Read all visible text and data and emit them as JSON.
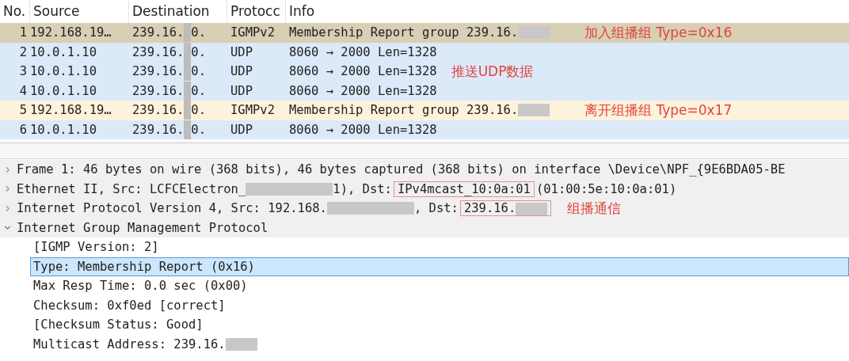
{
  "packet_list": {
    "columns": [
      "No.",
      "Source",
      "Destination",
      "Protocc",
      "Info"
    ],
    "rows": [
      {
        "no": "1",
        "source": "192.168.19…",
        "destination": [
          {
            "kind": "text",
            "text": "239.16."
          },
          {
            "kind": "redacted"
          },
          {
            "kind": "text",
            "text": "0."
          }
        ],
        "protocol": "IGMPv2",
        "info": [
          {
            "kind": "text",
            "text": "Membership Report group 239.16."
          },
          {
            "kind": "redacted"
          }
        ],
        "color": "#d8cfb4",
        "note": "加入组播组 Type=0x16"
      },
      {
        "no": "2",
        "source": "10.0.1.10",
        "destination": [
          {
            "kind": "text",
            "text": "239.16."
          },
          {
            "kind": "redacted"
          },
          {
            "kind": "text",
            "text": "0."
          }
        ],
        "protocol": "UDP",
        "info": [
          {
            "kind": "text",
            "text": "8060 → 2000 Len=1328"
          }
        ],
        "color": "#dbe9f8"
      },
      {
        "no": "3",
        "source": "10.0.1.10",
        "destination": [
          {
            "kind": "text",
            "text": "239.16."
          },
          {
            "kind": "redacted"
          },
          {
            "kind": "text",
            "text": "0."
          }
        ],
        "protocol": "UDP",
        "info": [
          {
            "kind": "text",
            "text": "8060 → 2000 Len=1328"
          }
        ],
        "color": "#dbe9f8",
        "side_note": "推送UDP数据"
      },
      {
        "no": "4",
        "source": "10.0.1.10",
        "destination": [
          {
            "kind": "text",
            "text": "239.16."
          },
          {
            "kind": "redacted"
          },
          {
            "kind": "text",
            "text": "0."
          }
        ],
        "protocol": "UDP",
        "info": [
          {
            "kind": "text",
            "text": "8060 → 2000 Len=1328"
          }
        ],
        "color": "#dbe9f8"
      },
      {
        "no": "5",
        "source": "192.168.19…",
        "destination": [
          {
            "kind": "text",
            "text": "239.16."
          },
          {
            "kind": "redacted"
          },
          {
            "kind": "text",
            "text": "0."
          }
        ],
        "protocol": "IGMPv2",
        "info": [
          {
            "kind": "text",
            "text": "Membership Report group 239.16."
          },
          {
            "kind": "redacted"
          }
        ],
        "color": "#fdf2db",
        "note": "离开组播组 Type=0x17"
      },
      {
        "no": "6",
        "source": "10.0.1.10",
        "destination": [
          {
            "kind": "text",
            "text": "239.16."
          },
          {
            "kind": "redacted"
          },
          {
            "kind": "text",
            "text": "0."
          }
        ],
        "protocol": "UDP",
        "info": [
          {
            "kind": "text",
            "text": "8060 → 2000 Len=1328"
          }
        ],
        "color": "#dbe9f8"
      }
    ]
  },
  "packet_details": [
    {
      "expanded": false,
      "segments": [
        {
          "kind": "text",
          "text": "Frame 1: 46 bytes on wire (368 bits), 46 bytes captured (368 bits) on interface \\Device\\NPF_{9E6BDA05-BE"
        }
      ]
    },
    {
      "expanded": false,
      "segments": [
        {
          "kind": "text",
          "text": "Ethernet II, Src: LCFCElectron_"
        },
        {
          "kind": "redacted"
        },
        {
          "kind": "text",
          "text": "1), Dst: "
        },
        {
          "kind": "boxed",
          "text": "IPv4mcast_10:0a:01"
        },
        {
          "kind": "text",
          "text": " (01:00:5e:10:0a:01)"
        }
      ]
    },
    {
      "expanded": false,
      "segments": [
        {
          "kind": "text",
          "text": "Internet Protocol Version 4, Src: 192.168."
        },
        {
          "kind": "redacted"
        },
        {
          "kind": "text",
          "text": ", Dst: "
        },
        {
          "kind": "boxed",
          "text": "239.16.",
          "redacted": true
        }
      ],
      "note": "组播通信"
    },
    {
      "expanded": true,
      "segments": [
        {
          "kind": "text",
          "text": "Internet Group Management Protocol"
        }
      ],
      "children": [
        {
          "selected": false,
          "segments": [
            {
              "kind": "text",
              "text": "[IGMP Version: 2]"
            }
          ]
        },
        {
          "selected": true,
          "segments": [
            {
              "kind": "text",
              "text": "Type: Membership Report (0x16)"
            }
          ]
        },
        {
          "selected": false,
          "segments": [
            {
              "kind": "text",
              "text": "Max Resp Time: 0.0 sec (0x00)"
            }
          ]
        },
        {
          "selected": false,
          "segments": [
            {
              "kind": "text",
              "text": "Checksum: 0xf0ed [correct]"
            }
          ]
        },
        {
          "selected": false,
          "segments": [
            {
              "kind": "text",
              "text": "[Checksum Status: Good]"
            }
          ]
        },
        {
          "selected": false,
          "segments": [
            {
              "kind": "text",
              "text": "Multicast Address: 239.16."
            },
            {
              "kind": "redacted"
            }
          ]
        }
      ]
    }
  ]
}
